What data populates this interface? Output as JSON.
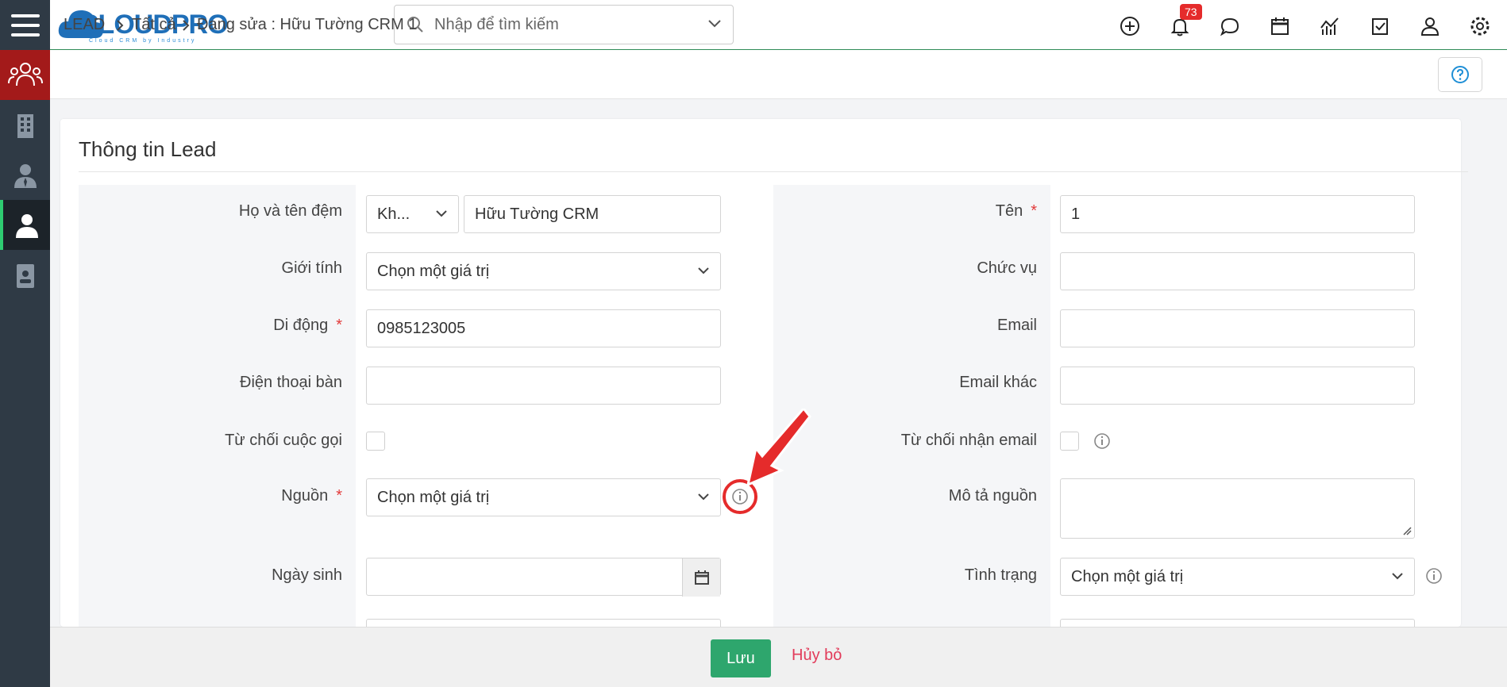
{
  "app": {
    "logo_text": "CLOUDPRO",
    "logo_sub": "Cloud CRM by Industry"
  },
  "search": {
    "placeholder": "Nhập để tìm kiếm"
  },
  "topbar": {
    "notification_count": "73"
  },
  "breadcrumb": {
    "module": "LEAD",
    "list": "Tất cả",
    "current": "Đang sửa : Hữu Tường CRM 1"
  },
  "form": {
    "title": "Thông tin Lead",
    "left": {
      "full_name": {
        "label": "Họ và tên đệm",
        "salutation": "Kh...",
        "value": "Hữu Tường CRM"
      },
      "gender": {
        "label": "Giới tính",
        "value": "Chọn một giá trị"
      },
      "mobile": {
        "label": "Di động",
        "required": "*",
        "value": "0985123005"
      },
      "phone": {
        "label": "Điện thoại bàn",
        "value": ""
      },
      "reject_call": {
        "label": "Từ chối cuộc gọi"
      },
      "source": {
        "label": "Nguồn",
        "required": "*",
        "value": "Chọn một giá trị"
      },
      "birthday": {
        "label": "Ngày sinh",
        "value": ""
      }
    },
    "right": {
      "first_name": {
        "label": "Tên",
        "required": "*",
        "value": "1"
      },
      "position": {
        "label": "Chức vụ",
        "value": ""
      },
      "email": {
        "label": "Email",
        "value": ""
      },
      "email_other": {
        "label": "Email khác",
        "value": ""
      },
      "reject_email": {
        "label": "Từ chối nhận email"
      },
      "source_desc": {
        "label": "Mô tả nguồn"
      },
      "status": {
        "label": "Tình trạng",
        "value": "Chọn một giá trị"
      }
    }
  },
  "footer": {
    "save_label": "Lưu",
    "cancel_label": "Hủy bỏ"
  },
  "colors": {
    "accent_green": "#2ea66d",
    "sidebar": "#2f3a45",
    "sidebar_red": "#a31a1a",
    "cancel": "#e23b5a",
    "callout_red": "#e52b2b"
  }
}
